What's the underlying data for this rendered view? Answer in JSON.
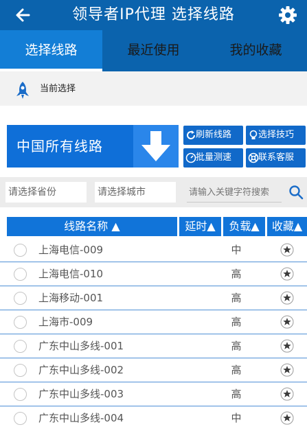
{
  "header": {
    "title": "领导者IP代理 选择线路",
    "back_icon": "back-arrow-icon",
    "settings_icon": "gear-icon"
  },
  "tabs": [
    {
      "label": "选择线路",
      "active": true
    },
    {
      "label": "最近使用",
      "active": false
    },
    {
      "label": "我的收藏",
      "active": false
    }
  ],
  "current": {
    "label": "当前选择",
    "icon": "rocket-icon"
  },
  "main_selector": {
    "label": "中国所有线路",
    "icon": "down-arrow-icon"
  },
  "actions": {
    "refresh": "刷新线路",
    "tips": "选择技巧",
    "speedtest": "批量测速",
    "support": "联系客服"
  },
  "filters": {
    "province": "请选择省份",
    "city": "请选择城市",
    "keyword_placeholder": "请输入关键字符搜索"
  },
  "table": {
    "columns": [
      "线路名称 ▲",
      "延时▲",
      "负载▲",
      "收藏▲"
    ],
    "rows": [
      {
        "name": "上海电信-009",
        "load": "中"
      },
      {
        "name": "上海电信-010",
        "load": "高"
      },
      {
        "name": "上海移动-001",
        "load": "高"
      },
      {
        "name": "上海市-009",
        "load": "高"
      },
      {
        "name": "广东中山多线-001",
        "load": "高"
      },
      {
        "name": "广东中山多线-002",
        "load": "高"
      },
      {
        "name": "广东中山多线-003",
        "load": "高"
      },
      {
        "name": "广东中山多线-004",
        "load": "中"
      }
    ]
  },
  "colors": {
    "primary": "#0b63ad",
    "accent": "#1174d9",
    "row_border": "#4e8fd6"
  }
}
